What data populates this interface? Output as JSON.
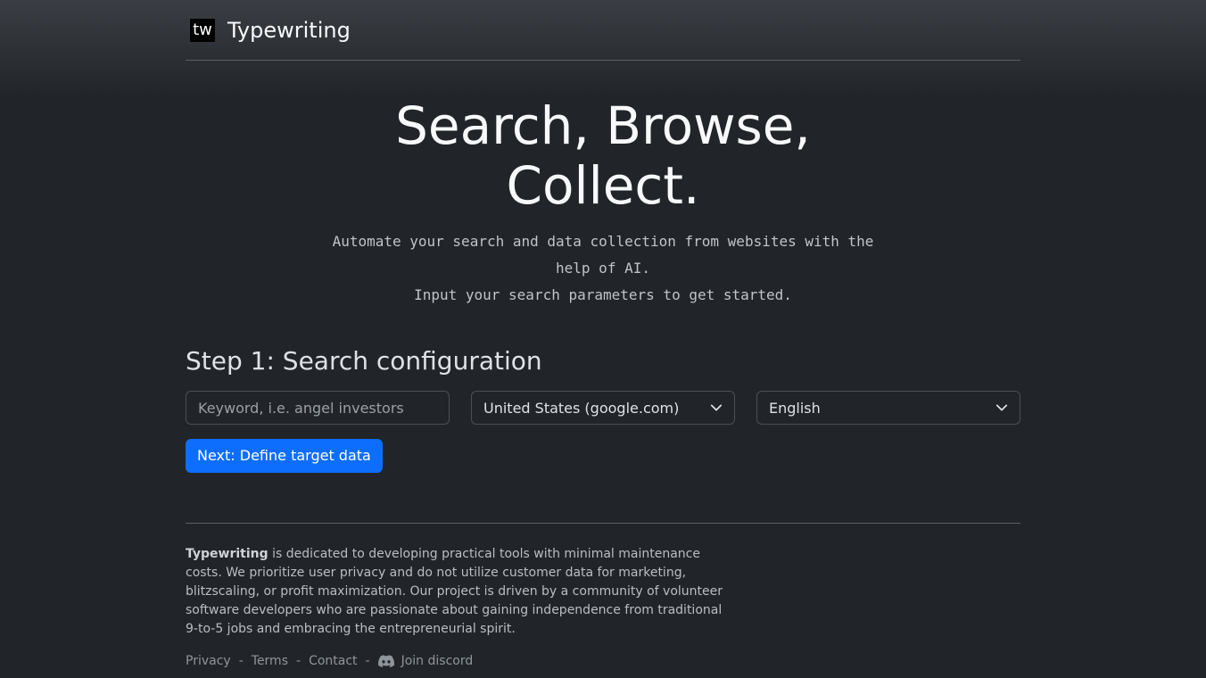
{
  "header": {
    "logo_text": "tw",
    "brand": "Typewriting"
  },
  "hero": {
    "title_line1": "Search, Browse,",
    "title_line2": "Collect.",
    "subtitle_line1": "Automate your search and data collection from websites with the help of AI.",
    "subtitle_line2": "Input your search parameters to get started."
  },
  "step1": {
    "heading": "Step 1: Search configuration",
    "keyword_placeholder": "Keyword, i.e. angel investors",
    "keyword_value": "",
    "country_selected": "United States (google.com)",
    "language_selected": "English",
    "next_button": "Next: Define target data"
  },
  "footer": {
    "brand": "Typewriting",
    "about": " is dedicated to developing practical tools with minimal maintenance costs. We prioritize user privacy and do not utilize customer data for marketing, blitzscaling, or profit maximization. Our project is driven by a community of volunteer software developers who are passionate about gaining independence from traditional 9-to-5 jobs and embracing the entrepreneurial spirit.",
    "links": {
      "privacy": "Privacy",
      "terms": "Terms",
      "contact": "Contact",
      "discord": "Join discord"
    },
    "separator": "-"
  },
  "icons": {
    "select_chevron": "chevron-down-icon",
    "discord": "discord-icon"
  },
  "colors": {
    "background": "#212529",
    "primary_button": "#0d6efd",
    "logo_bg": "#000000"
  }
}
